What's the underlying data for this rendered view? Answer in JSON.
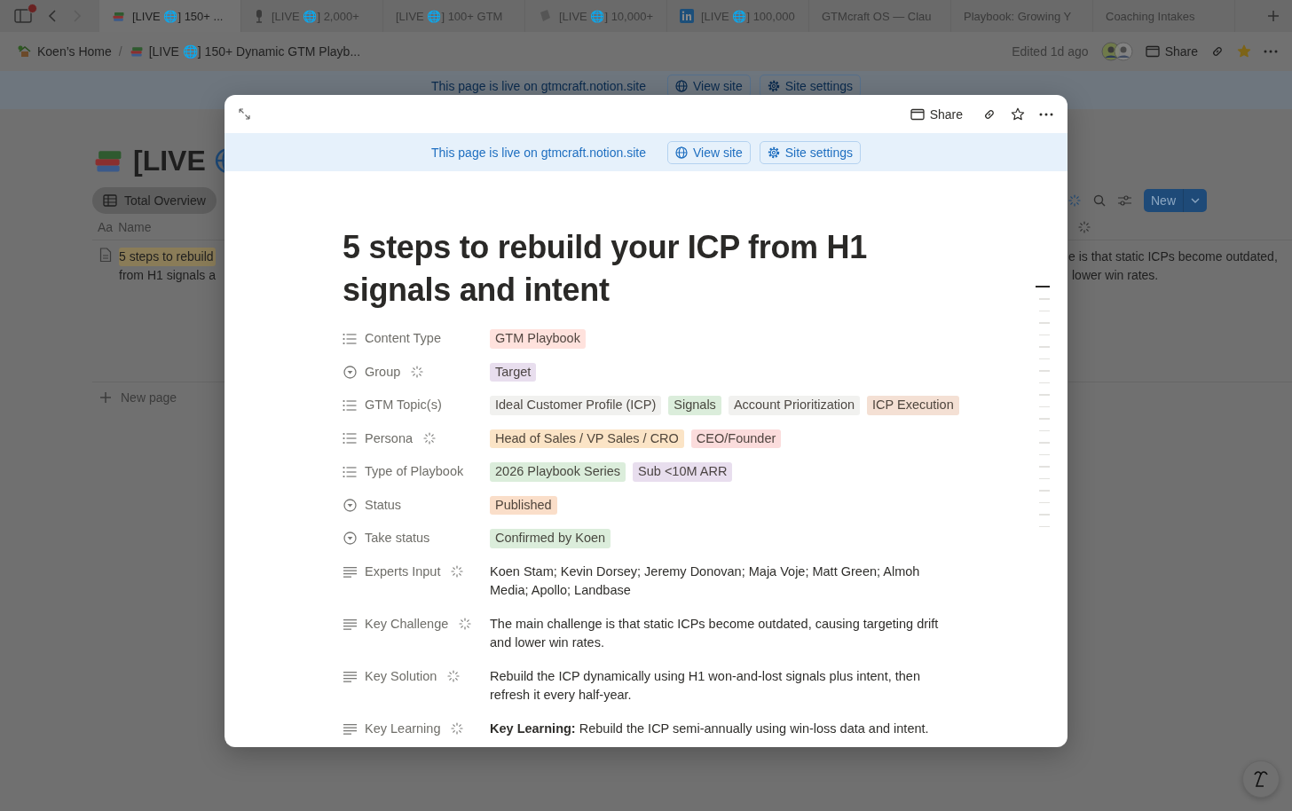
{
  "browser": {
    "sidebar_button": {
      "notification": true
    },
    "nav": {
      "forward_disabled": true
    },
    "tabs": [
      {
        "label": "[LIVE 🌐] 150+ ...",
        "selected": true
      },
      {
        "label": "[LIVE 🌐] 2,000+",
        "selected": false
      },
      {
        "label": "[LIVE 🌐] 100+ GTM",
        "selected": false
      },
      {
        "label": "[LIVE 🌐] 10,000+",
        "selected": false
      },
      {
        "label": "[LIVE 🌐] 100,000",
        "selected": false
      },
      {
        "label": "GTMcraft OS — Clau",
        "selected": false
      },
      {
        "label": "Playbook: Growing Y",
        "selected": false
      },
      {
        "label": "Coaching Intakes",
        "selected": false
      }
    ]
  },
  "topbar": {
    "breadcrumbs": [
      {
        "label": "Koen’s Home"
      },
      {
        "label": "[LIVE 🌐] 150+ Dynamic GTM Playb..."
      }
    ],
    "separator": "/",
    "edited": "Edited 1d ago",
    "share": "Share",
    "favorite": true
  },
  "background": {
    "banner": {
      "text": "This page is live on gtmcraft.notion.site",
      "view_site": "View site",
      "site_settings": "Site settings"
    },
    "title": "[LIVE",
    "view_tab": {
      "label": "Total Overview",
      "selected": true
    },
    "column": {
      "icon_text": "Aa",
      "label": "Name"
    },
    "row": {
      "name_lines": [
        "5 steps to rebuild",
        "from H1 signals a"
      ],
      "highlighted": true,
      "challenge_lines": [
        "e is that static ICPs become outdated,",
        "lower win rates."
      ]
    },
    "new_page": "New page",
    "new_button": "New"
  },
  "modal": {
    "share": "Share",
    "favorite": false,
    "banner": {
      "text": "This page is live on gtmcraft.notion.site",
      "view_site": "View site",
      "site_settings": "Site settings"
    },
    "title": "5 steps to rebuild your ICP from H1 signals and intent",
    "properties": [
      {
        "kind": "multi_select",
        "label": "Content Type",
        "ai": false,
        "tags": [
          {
            "label": "GTM Playbook",
            "color": "#ffe2dd"
          }
        ]
      },
      {
        "kind": "select",
        "label": "Group",
        "ai": true,
        "tags": [
          {
            "label": "Target",
            "color": "#e8deee"
          }
        ]
      },
      {
        "kind": "multi_select",
        "label": "GTM Topic(s)",
        "ai": false,
        "tags": [
          {
            "label": "Ideal Customer Profile (ICP)",
            "color": "#f1f1ef"
          },
          {
            "label": "Signals",
            "color": "#dbeddb"
          },
          {
            "label": "Account Prioritization",
            "color": "#f1f1ef"
          },
          {
            "label": "ICP Execution",
            "color": "#f4e0d4"
          }
        ]
      },
      {
        "kind": "multi_select",
        "label": "Persona",
        "ai": true,
        "tags": [
          {
            "label": "Head of Sales / VP Sales / CRO",
            "color": "#fbe4c6"
          },
          {
            "label": "CEO/Founder",
            "color": "#fbdcdc"
          }
        ]
      },
      {
        "kind": "multi_select",
        "label": "Type of Playbook",
        "ai": false,
        "tags": [
          {
            "label": "2026 Playbook Series",
            "color": "#dbeddb"
          },
          {
            "label": "Sub <10M ARR",
            "color": "#e8deee"
          }
        ]
      },
      {
        "kind": "select",
        "label": "Status",
        "ai": false,
        "tags": [
          {
            "label": "Published",
            "color": "#fadec9"
          }
        ]
      },
      {
        "kind": "select",
        "label": "Take status",
        "ai": false,
        "tags": [
          {
            "label": "Confirmed by Koen",
            "color": "#dbeddb"
          }
        ]
      },
      {
        "kind": "text",
        "label": "Experts Input",
        "ai": true,
        "value": "Koen Stam; Kevin Dorsey; Jeremy Donovan; Maja Voje; Matt Green; Almoh Media; Apollo; Landbase"
      },
      {
        "kind": "text",
        "label": "Key Challenge",
        "ai": true,
        "value": "The main challenge is that static ICPs become outdated, causing targeting drift and lower win rates."
      },
      {
        "kind": "text",
        "label": "Key Solution",
        "ai": true,
        "value": "Rebuild the ICP dynamically using H1 won-and-lost signals plus intent, then refresh it every half-year."
      },
      {
        "kind": "text",
        "label": "Key Learning",
        "ai": true,
        "value": "**Key Learning:** Rebuild the ICP semi-annually using win-loss data and intent."
      }
    ],
    "toc": [
      {
        "selected": true
      },
      {
        "selected": false
      },
      {
        "selected": false
      },
      {
        "selected": false
      },
      {
        "selected": false
      },
      {
        "selected": false
      },
      {
        "selected": false
      },
      {
        "selected": false
      },
      {
        "selected": false
      },
      {
        "selected": false
      },
      {
        "selected": false
      },
      {
        "selected": false
      },
      {
        "selected": false
      },
      {
        "selected": false
      },
      {
        "selected": false
      },
      {
        "selected": false
      },
      {
        "selected": false
      },
      {
        "selected": false
      },
      {
        "selected": false
      },
      {
        "selected": false
      },
      {
        "selected": false
      }
    ]
  }
}
